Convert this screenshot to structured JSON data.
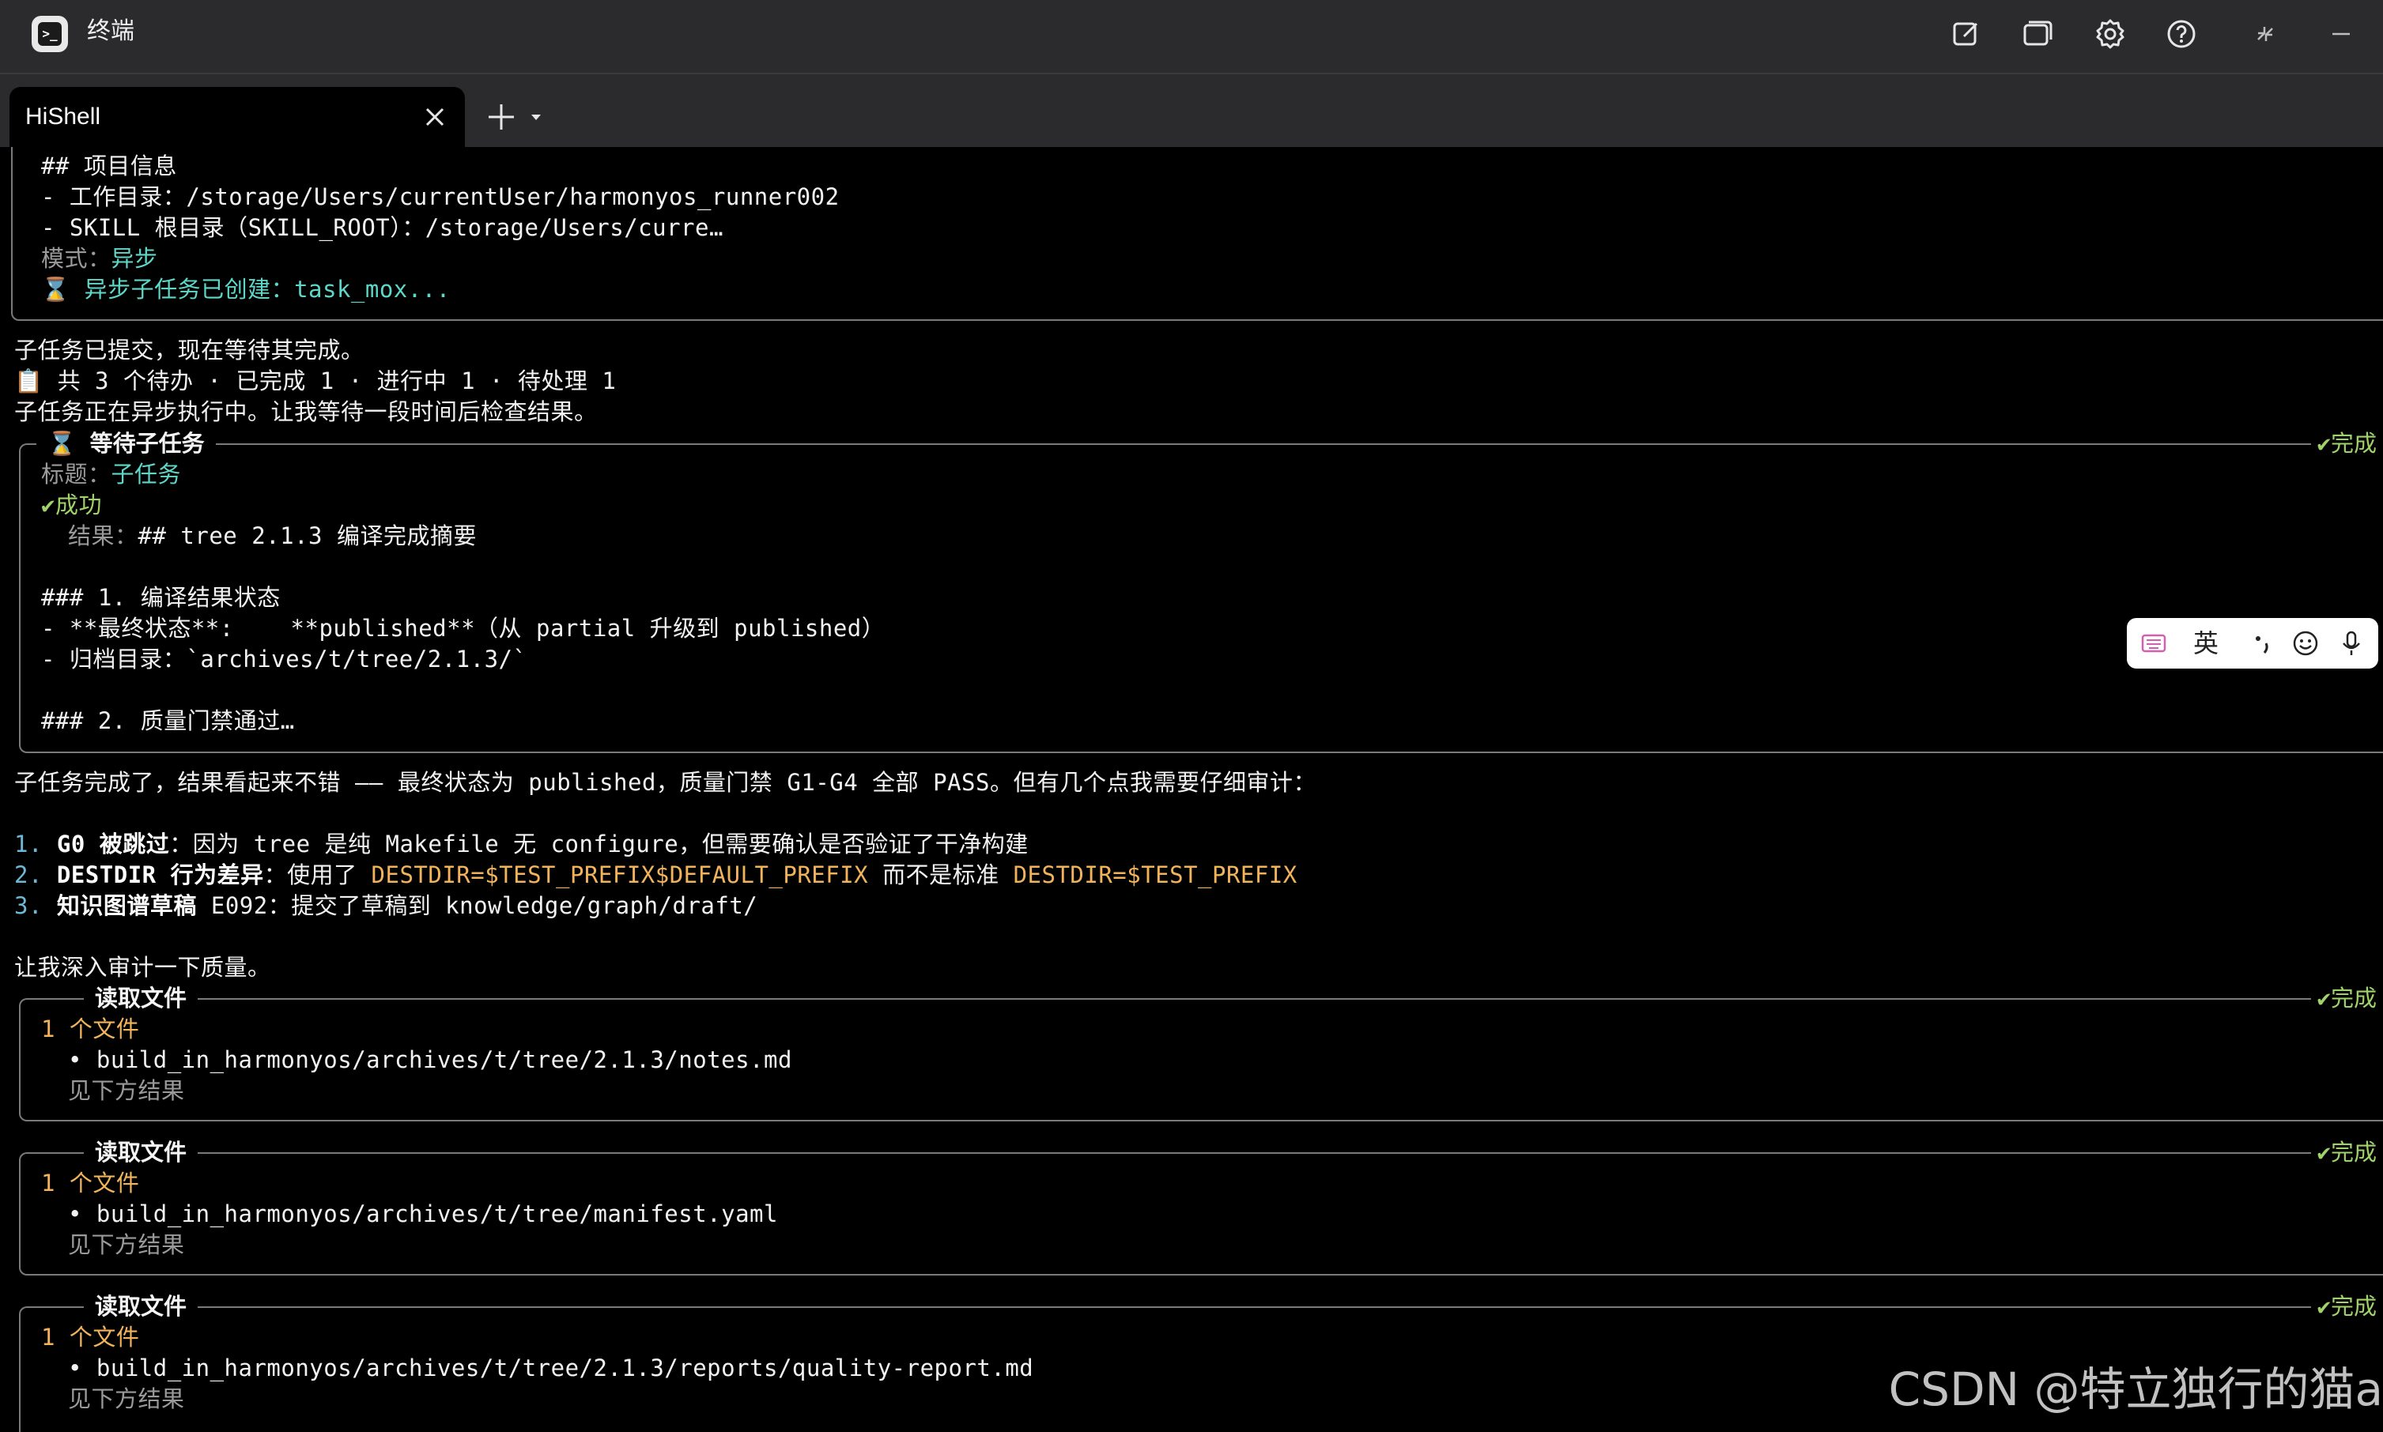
{
  "window": {
    "title": "终端",
    "icons": [
      "terminal-app-icon",
      "new-window-icon",
      "split-window-icon",
      "settings-icon",
      "help-icon",
      "restore-icon",
      "minimize-icon"
    ]
  },
  "tabs": [
    {
      "label": "HiShell",
      "active": true
    }
  ],
  "terminal": {
    "project": {
      "heading": "## 项目信息",
      "workdir": "- 工作目录：/storage/Users/currentUser/harmonyos_runner002",
      "skill_root": "- SKILL 根目录（SKILL_ROOT）：/storage/Users/curre…",
      "mode_label": "模式：",
      "mode_value": "异步",
      "async_created_icon": "⌛",
      "async_created_label": "异步子任务已创建：",
      "async_created_value": "task_mox..."
    },
    "msg1": "子任务已提交，现在等待其完成。",
    "todo": "📋 共 3 个待办 · 已完成 1 · 进行中 1 · 待处理 1",
    "msg2": "子任务正在异步执行中。让我等待一段时间后检查结果。",
    "wait_box": {
      "icon": "⌛",
      "title": "等待子任务",
      "status": "✔完成",
      "label_title": "标题：",
      "label_value": "子任务",
      "success": "✔成功",
      "result_label": "结果：",
      "result_value": "## tree 2.1.3 编译完成摘要",
      "section1": "### 1. 编译结果状态",
      "final_state": "- **最终状态**:    **published**（从 partial 升级到 published）",
      "archive_dir": "- 归档目录：`archives/t/tree/2.1.3/`",
      "section2": "### 2. 质量门禁通过…"
    },
    "msg3": "子任务完成了，结果看起来不错 —— 最终状态为 published，质量门禁 G1-G4 全部 PASS。但有几个点我需要仔细审计：",
    "audit": [
      {
        "num": "1.",
        "bold": "G0 被跳过",
        "rest": "：因为 tree 是纯 Makefile 无 configure，但需要确认是否验证了干净构建"
      },
      {
        "num": "2.",
        "bold": "DESTDIR 行为差异",
        "rest": "：使用了 ",
        "code1": "DESTDIR=$TEST_PREFIX$DEFAULT_PREFIX",
        "mid": " 而不是标准 ",
        "code2": "DESTDIR=$TEST_PREFIX"
      },
      {
        "num": "3.",
        "bold": "知识图谱草稿",
        "rest": " E092：提交了草稿到 knowledge/graph/draft/"
      }
    ],
    "msg4": "让我深入审计一下质量。",
    "read_boxes": [
      {
        "title": "读取文件",
        "status": "✔完成",
        "count": "1 个文件",
        "path": "• build_in_harmonyos/archives/t/tree/2.1.3/notes.md",
        "note": "见下方结果"
      },
      {
        "title": "读取文件",
        "status": "✔完成",
        "count": "1 个文件",
        "path": "• build_in_harmonyos/archives/t/tree/manifest.yaml",
        "note": "见下方结果"
      },
      {
        "title": "读取文件",
        "status": "✔完成",
        "count": "1 个文件",
        "path": "• build_in_harmonyos/archives/t/tree/2.1.3/reports/quality-report.md",
        "note": "见下方结果"
      }
    ]
  },
  "ime_toolbar": {
    "lang": "英",
    "icons": [
      "keyboard-switch-icon",
      "punctuation-icon",
      "emoji-icon",
      "microphone-icon"
    ]
  },
  "watermark": "CSDN @特立独行的猫a"
}
